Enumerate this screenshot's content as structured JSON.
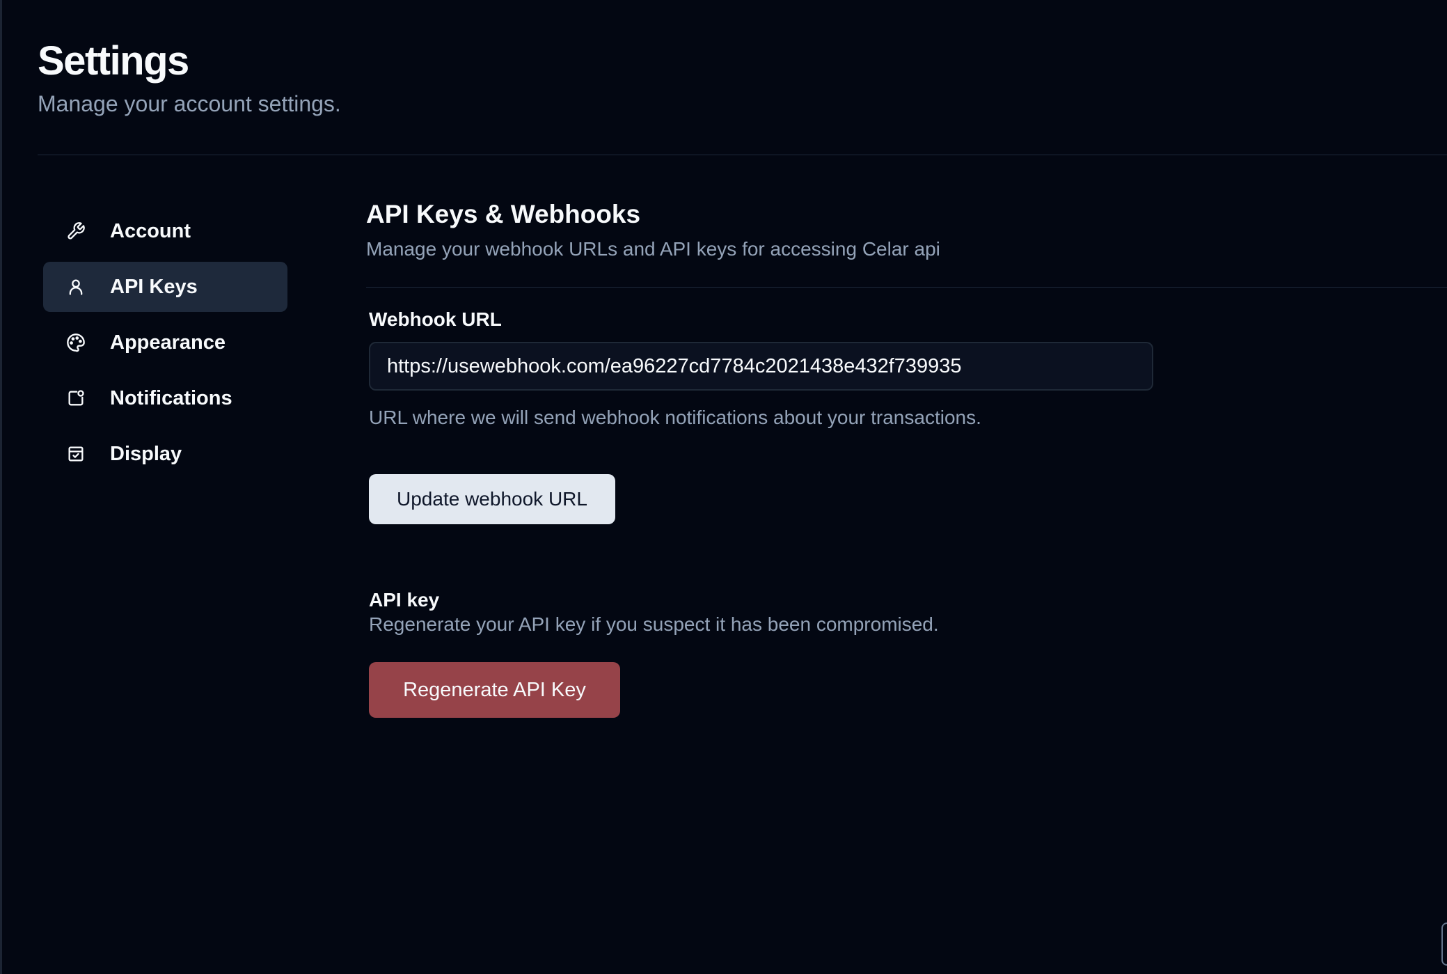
{
  "header": {
    "title": "Settings",
    "subtitle": "Manage your account settings."
  },
  "sidebar": {
    "items": [
      {
        "label": "Account",
        "icon": "wrench-icon",
        "active": false
      },
      {
        "label": "API Keys",
        "icon": "user-icon",
        "active": true
      },
      {
        "label": "Appearance",
        "icon": "palette-icon",
        "active": false
      },
      {
        "label": "Notifications",
        "icon": "bell-square-icon",
        "active": false
      },
      {
        "label": "Display",
        "icon": "calendar-check-icon",
        "active": false
      }
    ]
  },
  "main": {
    "title": "API Keys & Webhooks",
    "subtitle": "Manage your webhook URLs and API keys for accessing Celar api",
    "webhook": {
      "label": "Webhook URL",
      "value": "https://usewebhook.com/ea96227cd7784c2021438e432f739935",
      "help": "URL where we will send webhook notifications about your transactions.",
      "button_label": "Update webhook URL"
    },
    "api_key": {
      "label": "API key",
      "help": "Regenerate your API key if you suspect it has been compromised.",
      "button_label": "Regenerate API Key"
    }
  },
  "colors": {
    "background": "#030712",
    "active_nav": "#1e293b",
    "danger": "#964349",
    "muted_text": "#94a3b8"
  }
}
